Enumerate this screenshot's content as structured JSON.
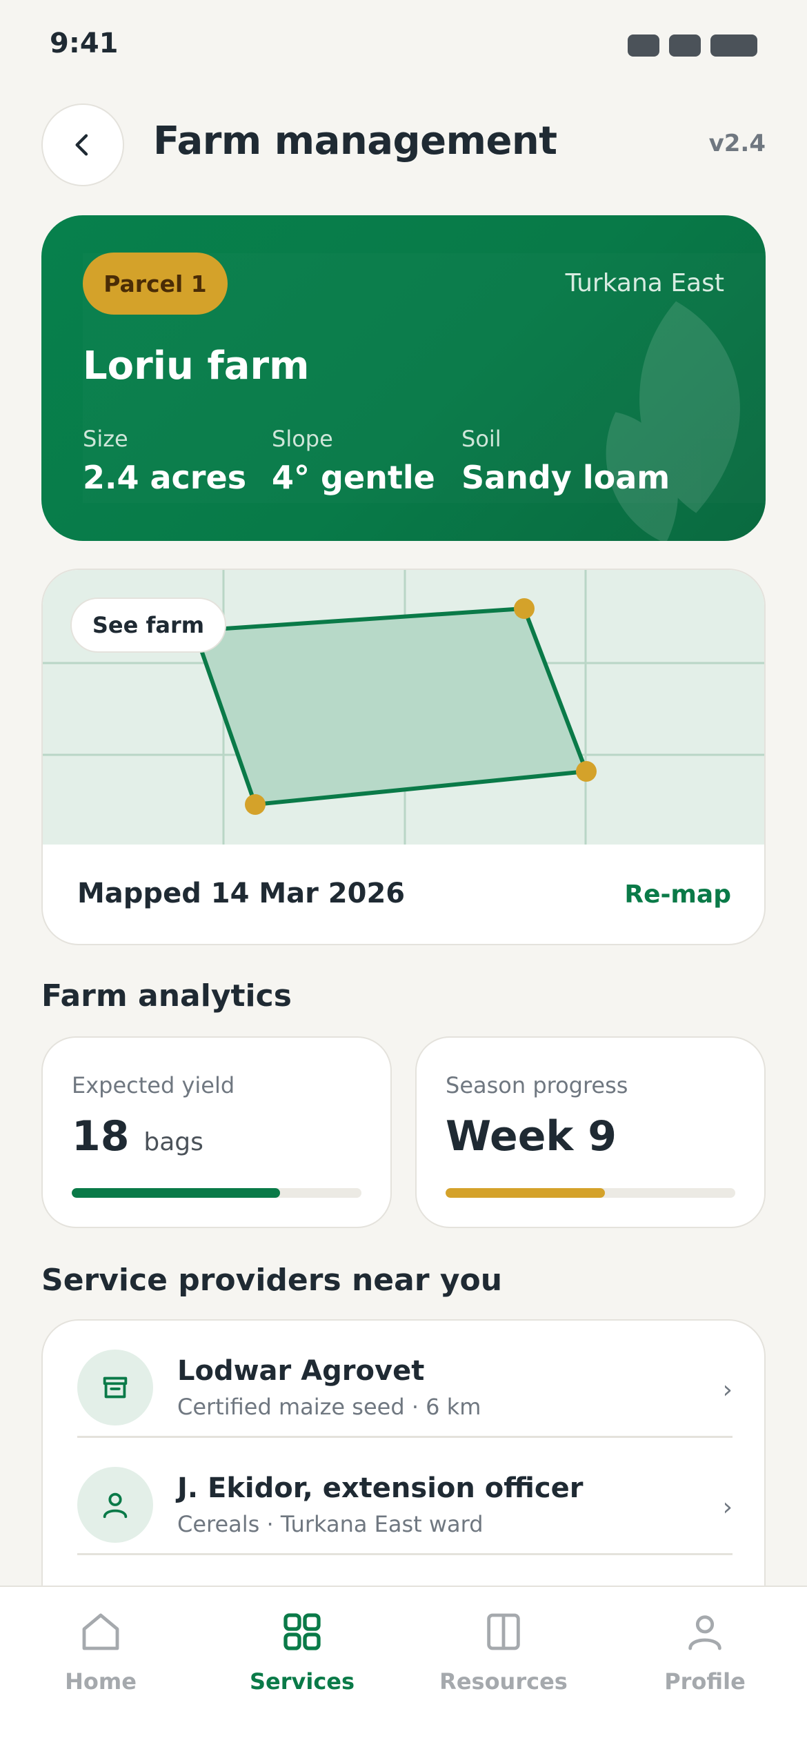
{
  "status": {
    "time": "9:41"
  },
  "header": {
    "title": "Farm management",
    "version": "v2.4",
    "back_icon": "chevron-left-icon"
  },
  "parcel": {
    "badge": "Parcel 1",
    "region": "Turkana East",
    "farm_name": "Loriu farm",
    "stats": [
      {
        "label": "Size",
        "value": "2.4 acres"
      },
      {
        "label": "Slope",
        "value": "4° gentle"
      },
      {
        "label": "Soil",
        "value": "Sandy loam"
      }
    ]
  },
  "map": {
    "see_farm_label": "See farm",
    "mapped_text": "Mapped 14 Mar 2026",
    "remap_label": "Re-map"
  },
  "analytics": {
    "title": "Farm analytics",
    "yield": {
      "label": "Expected yield",
      "value": "18",
      "unit": "bags",
      "progress": 0.72
    },
    "season": {
      "label": "Season progress",
      "value": "Week 9",
      "progress": 0.55
    }
  },
  "providers": {
    "title": "Service providers near you",
    "items": [
      {
        "name": "Lodwar Agrovet",
        "sub": "Certified maize seed · 6 km",
        "icon": "store-icon"
      },
      {
        "name": "J. Ekidor, extension officer",
        "sub": "Cereals · Turkana East ward",
        "icon": "person-icon"
      }
    ],
    "chevron": "›"
  },
  "nav": {
    "items": [
      {
        "label": "Home",
        "icon": "home-icon",
        "active": false
      },
      {
        "label": "Services",
        "icon": "grid-icon",
        "active": true
      },
      {
        "label": "Resources",
        "icon": "book-icon",
        "active": false
      },
      {
        "label": "Profile",
        "icon": "person-icon",
        "active": false
      }
    ]
  },
  "colors": {
    "brand_green": "#0a7a48",
    "accent_gold": "#d4a22a",
    "background": "#f6f5f1"
  }
}
